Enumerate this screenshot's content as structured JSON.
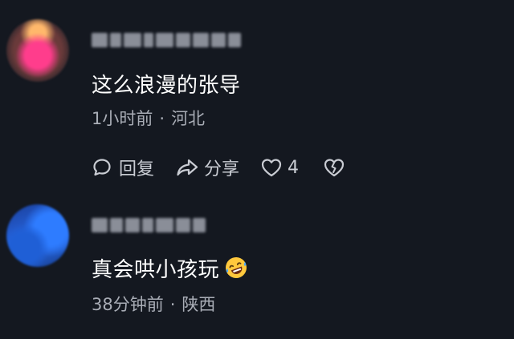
{
  "comments": [
    {
      "text": "这么浪漫的张导",
      "time": "1小时前",
      "separator": "·",
      "location": "河北",
      "actions": {
        "reply_label": "回复",
        "share_label": "分享",
        "like_count": "4"
      }
    },
    {
      "text": "真会哄小孩玩",
      "time": "38分钟前",
      "separator": "·",
      "location": "陕西"
    }
  ],
  "colors": {
    "background": "#141820",
    "primary_text": "#ffffff",
    "secondary_text": "#a9adb6",
    "action_text": "#c9ccd3"
  },
  "icons": [
    "reply-icon",
    "share-icon",
    "heart-icon",
    "broken-heart-icon",
    "laughing-emoji-icon"
  ]
}
